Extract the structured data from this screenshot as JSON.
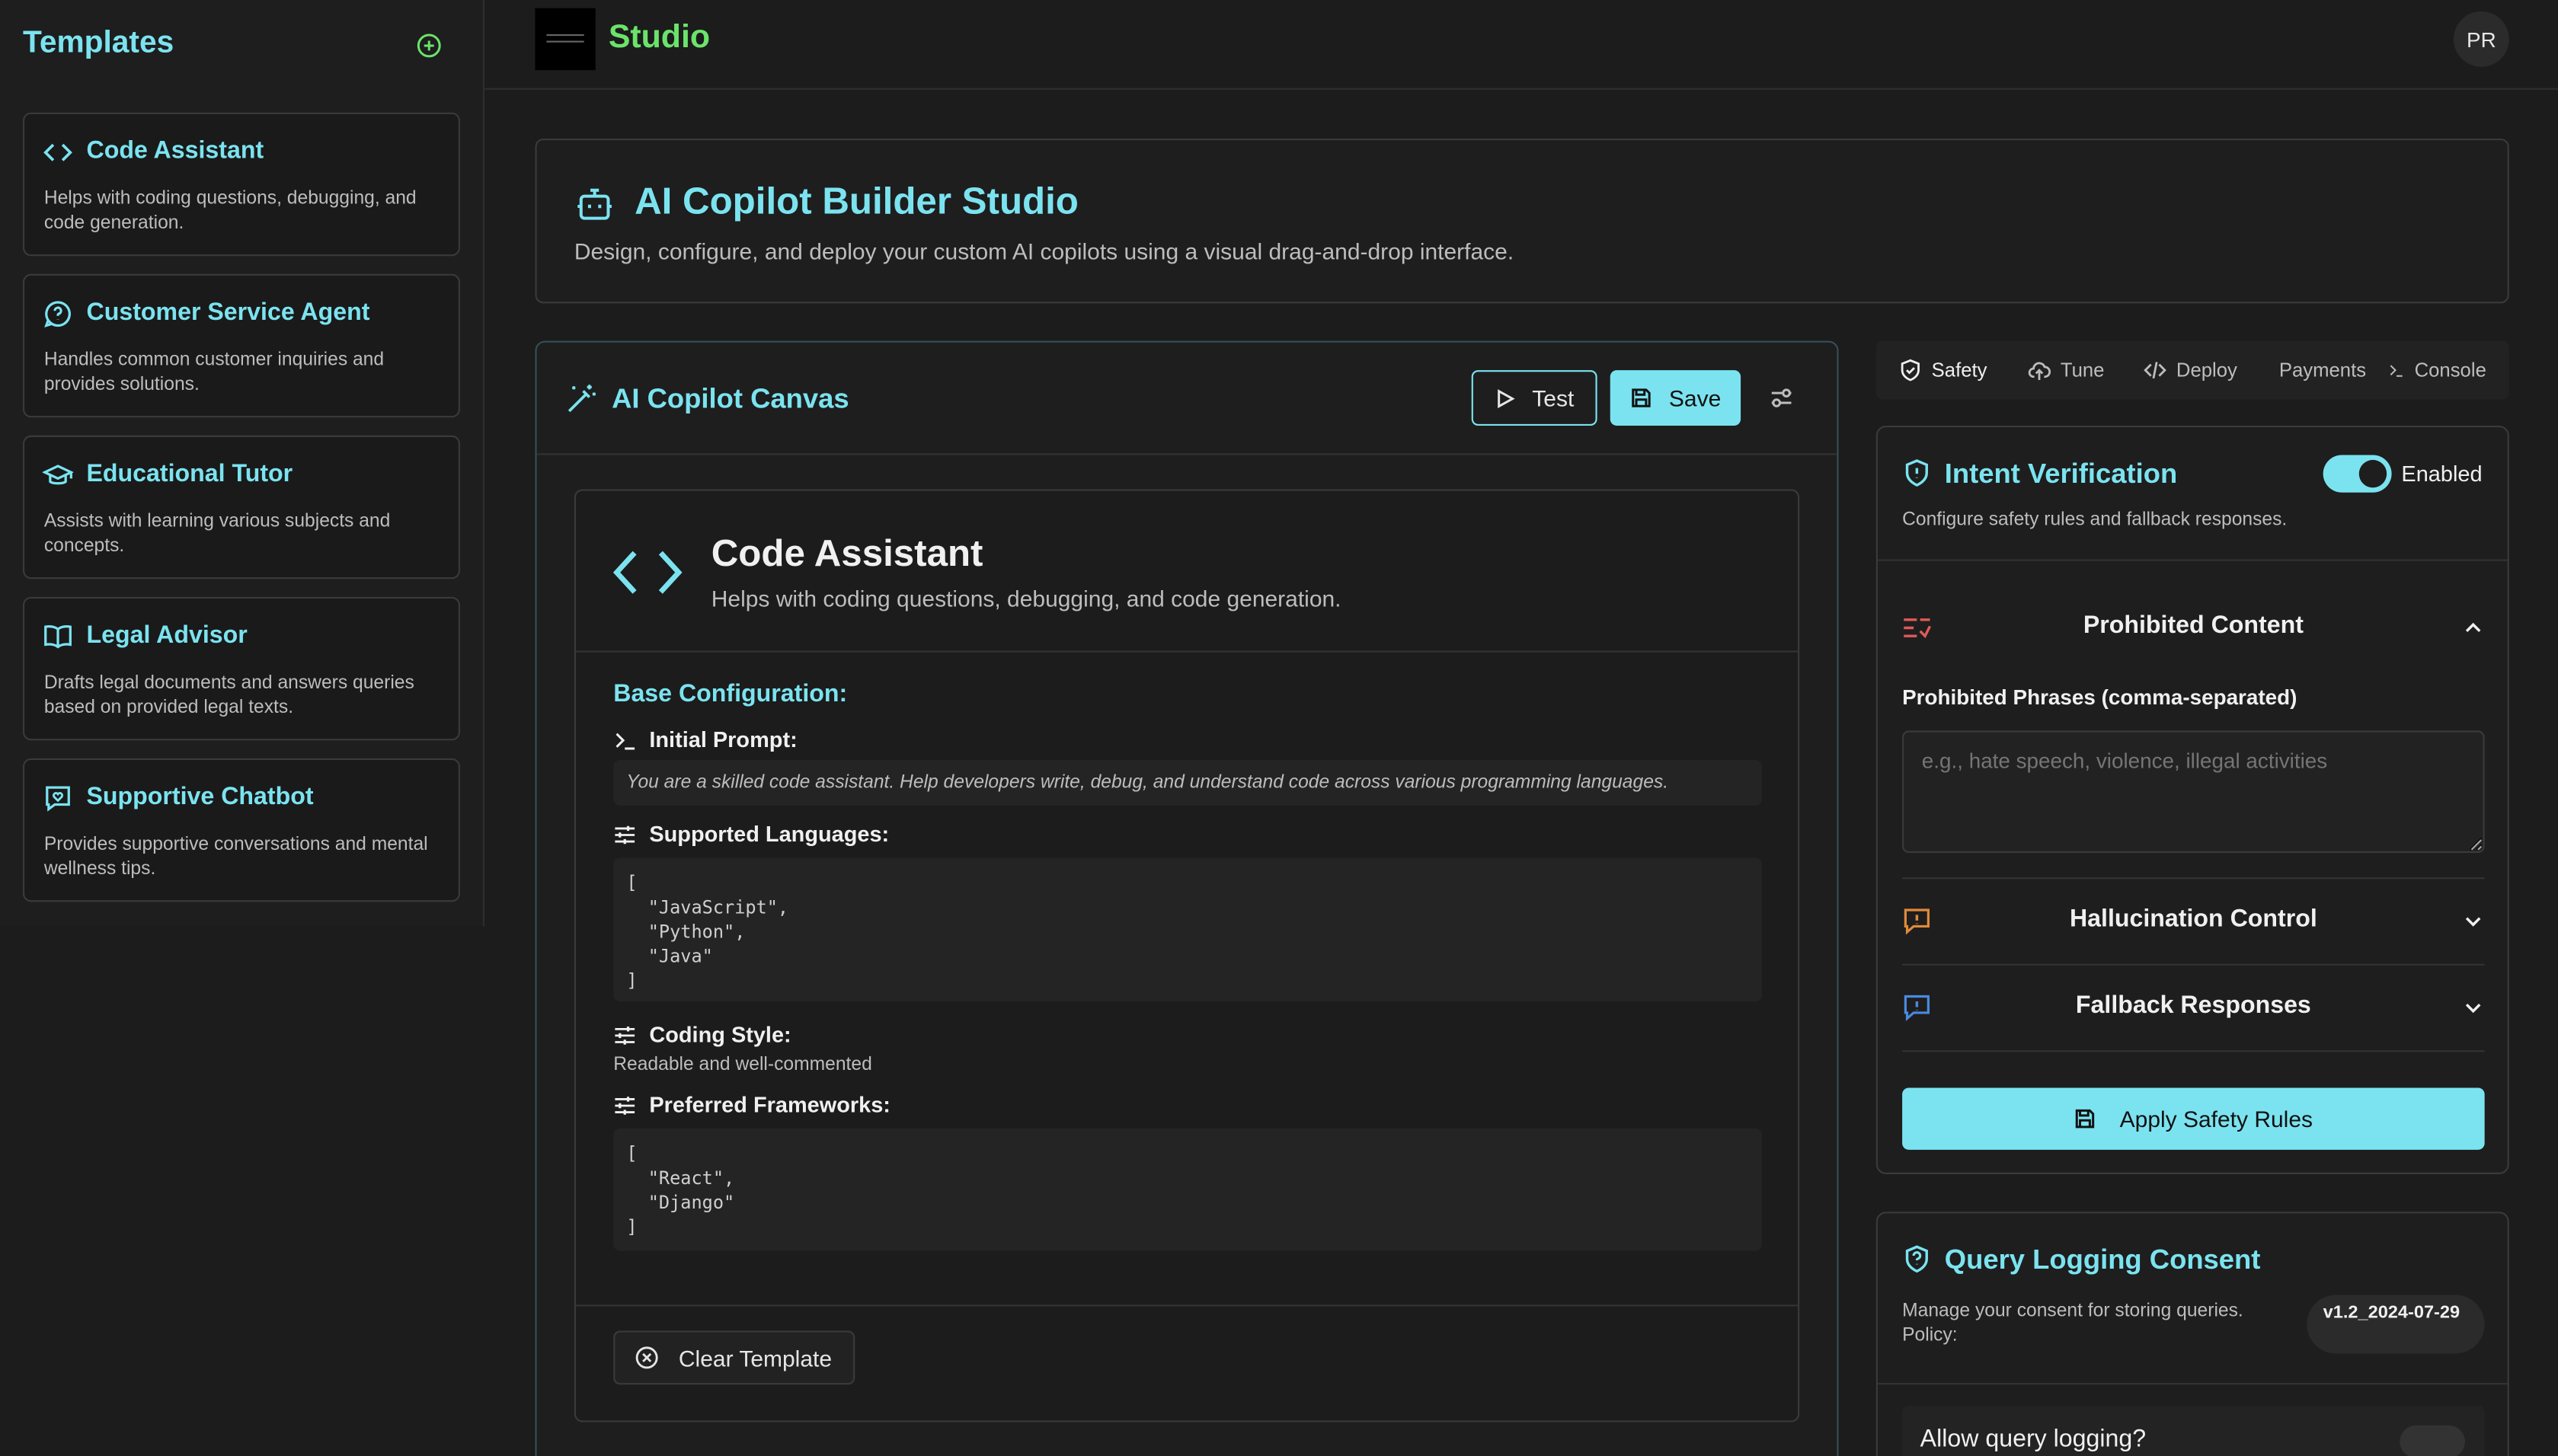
{
  "sidebar": {
    "title": "Templates",
    "templates": [
      {
        "name": "Code Assistant",
        "description": "Helps with coding questions, debugging, and code generation.",
        "icon": "code-icon"
      },
      {
        "name": "Customer Service Agent",
        "description": "Handles common customer inquiries and provides solutions.",
        "icon": "message-question-icon"
      },
      {
        "name": "Educational Tutor",
        "description": "Assists with learning various subjects and concepts.",
        "icon": "graduation-cap-icon"
      },
      {
        "name": "Legal Advisor",
        "description": "Drafts legal documents and answers queries based on provided legal texts.",
        "icon": "book-open-icon"
      },
      {
        "name": "Supportive Chatbot",
        "description": "Provides supportive conversations and mental wellness tips.",
        "icon": "message-heart-icon"
      }
    ]
  },
  "header": {
    "app_name": "Studio",
    "avatar_initials": "PR"
  },
  "hero": {
    "title": "AI Copilot Builder Studio",
    "description": "Design, configure, and deploy your custom AI copilots using a visual drag-and-drop interface."
  },
  "canvas": {
    "title": "AI Copilot Canvas",
    "test_label": "Test",
    "save_label": "Save",
    "template": {
      "name": "Code Assistant",
      "description": "Helps with coding questions, debugging, and code generation.",
      "base_title": "Base Configuration:",
      "initial_prompt_label": "Initial Prompt:",
      "initial_prompt": "You are a skilled code assistant. Help developers write, debug, and understand code across various programming languages.",
      "languages_label": "Supported Languages:",
      "languages_code": "[\n  \"JavaScript\",\n  \"Python\",\n  \"Java\"\n]",
      "coding_style_label": "Coding Style:",
      "coding_style": "Readable and well-commented",
      "frameworks_label": "Preferred Frameworks:",
      "frameworks_code": "[\n  \"React\",\n  \"Django\"\n]",
      "clear_label": "Clear Template"
    }
  },
  "tabs": [
    {
      "label": "Safety",
      "icon": "shield-check-icon",
      "active": true
    },
    {
      "label": "Tune",
      "icon": "cloud-upload-icon"
    },
    {
      "label": "Deploy",
      "icon": "code-icon"
    },
    {
      "label": "Payments",
      "icon": ""
    },
    {
      "label": "Console",
      "icon": "terminal-icon"
    }
  ],
  "intent": {
    "title": "Intent Verification",
    "toggle_label": "Enabled",
    "subtitle": "Configure safety rules and fallback responses.",
    "sections": [
      {
        "title": "Prohibited Content",
        "color": "#e05a5a"
      },
      {
        "title": "Hallucination Control",
        "color": "#e08a3a"
      },
      {
        "title": "Fallback Responses",
        "color": "#4a8ae0"
      }
    ],
    "phrases_label": "Prohibited Phrases (comma-separated)",
    "phrases_placeholder": "e.g., hate speech, violence, illegal activities",
    "apply_label": "Apply Safety Rules"
  },
  "qlog": {
    "title": "Query Logging Consent",
    "subtitle": "Manage your consent for storing queries. Policy:",
    "policy_version": "v1.2_2024-07-29",
    "allow_label": "Allow query logging?"
  },
  "colors": {
    "accent": "#7be3f0",
    "brand_green": "#6be36b",
    "background": "#1c1c1c"
  }
}
